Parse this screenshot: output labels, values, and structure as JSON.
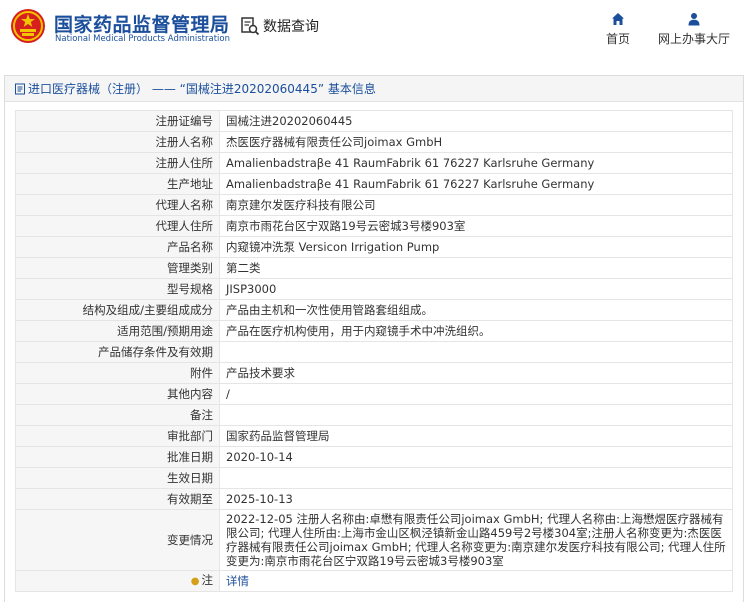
{
  "header": {
    "org_name_cn": "国家药品监督管理局",
    "org_name_en": "National Medical Products Administration",
    "query_label": "数据查询",
    "nav_home": "首页",
    "nav_office": "网上办事大厅"
  },
  "panel": {
    "title": "进口医疗器械（注册） —— “国械注进20202060445” 基本信息"
  },
  "rows": [
    {
      "label": "注册证编号",
      "value": "国械注进20202060445"
    },
    {
      "label": "注册人名称",
      "value": "杰医医疗器械有限责任公司joimax GmbH"
    },
    {
      "label": "注册人住所",
      "value": "Amalienbadstraβe 41 RaumFabrik 61 76227 Karlsruhe Germany"
    },
    {
      "label": "生产地址",
      "value": "Amalienbadstraβe 41 RaumFabrik 61 76227 Karlsruhe Germany"
    },
    {
      "label": "代理人名称",
      "value": "南京建尔发医疗科技有限公司"
    },
    {
      "label": "代理人住所",
      "value": "南京市雨花台区宁双路19号云密城3号楼903室"
    },
    {
      "label": "产品名称",
      "value": "内窥镜冲洗泵 Versicon Irrigation Pump"
    },
    {
      "label": "管理类别",
      "value": "第二类"
    },
    {
      "label": "型号规格",
      "value": "JISP3000"
    },
    {
      "label": "结构及组成/主要组成成分",
      "value": "产品由主机和一次性使用管路套组组成。"
    },
    {
      "label": "适用范围/预期用途",
      "value": "产品在医疗机构使用，用于内窥镜手术中冲洗组织。"
    },
    {
      "label": "产品储存条件及有效期",
      "value": ""
    },
    {
      "label": "附件",
      "value": "产品技术要求"
    },
    {
      "label": "其他内容",
      "value": "/"
    },
    {
      "label": "备注",
      "value": ""
    },
    {
      "label": "审批部门",
      "value": "国家药品监督管理局"
    },
    {
      "label": "批准日期",
      "value": "2020-10-14"
    },
    {
      "label": "生效日期",
      "value": ""
    },
    {
      "label": "有效期至",
      "value": "2025-10-13"
    },
    {
      "label": "变更情况",
      "value": "2022-12-05 注册人名称由:卓懋有限责任公司joimax GmbH; 代理人名称由:上海懋煜医疗器械有限公司; 代理人住所由:上海市金山区枫泾镇新金山路459号2号楼304室;注册人名称变更为:杰医医疗器械有限责任公司joimax GmbH; 代理人名称变更为:南京建尔发医疗科技有限公司; 代理人住所变更为:南京市雨花台区宁双路19号云密城3号楼903室"
    },
    {
      "label": "注",
      "value": "详情"
    }
  ],
  "colors": {
    "brand_blue": "#1b4f9c",
    "emblem_red": "#d71f1f",
    "emblem_gold": "#f3c400"
  }
}
